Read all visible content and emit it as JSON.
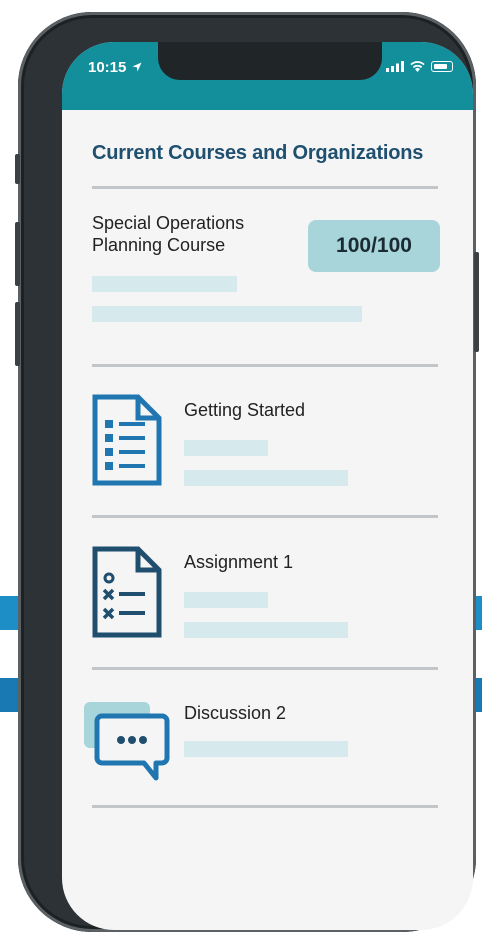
{
  "status_bar": {
    "time": "10:15"
  },
  "main": {
    "heading": "Current Courses and Organizations",
    "course": {
      "name": "Special Operations Planning Course",
      "score": "100/100"
    },
    "items": [
      {
        "label": "Getting Started",
        "icon": "document-list-icon"
      },
      {
        "label": "Assignment 1",
        "icon": "quiz-document-icon"
      },
      {
        "label": "Discussion 2",
        "icon": "chat-bubbles-icon"
      }
    ]
  },
  "colors": {
    "status_bar": "#138f9c",
    "heading": "#1f5070",
    "score_badge": "#a7d5d9",
    "icon_blue": "#1f76b0",
    "icon_navy": "#1f4e6f",
    "placeholder": "#d6e9ec"
  }
}
